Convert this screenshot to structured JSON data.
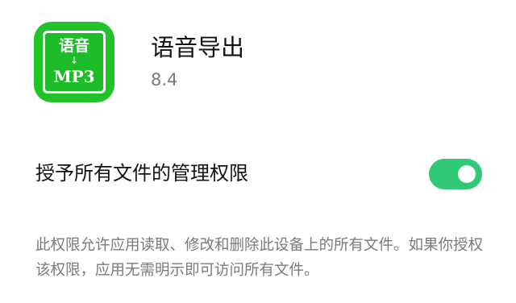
{
  "app": {
    "icon": {
      "name": "voice-to-mp3-icon",
      "title": "语音",
      "arrow": "↓",
      "format": "MP3",
      "color": "#22c32a"
    },
    "name": "语音导出",
    "version": "8.4"
  },
  "permission": {
    "label": "授予所有文件的管理权限",
    "enabled": true,
    "toggle_color": "#2fc977",
    "description": "此权限允许应用读取、修改和删除此设备上的所有文件。如果你授权该权限，应用无需明示即可访问所有文件。"
  }
}
